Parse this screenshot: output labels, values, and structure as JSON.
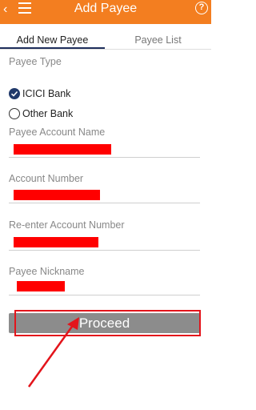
{
  "header": {
    "title": "Add Payee",
    "back_glyph": "‹",
    "help_glyph": "?",
    "bg_color": "#f37e20"
  },
  "tabs": [
    {
      "label": "Add New Payee",
      "active": true
    },
    {
      "label": "Payee List",
      "active": false
    }
  ],
  "form": {
    "payee_type_label": "Payee Type",
    "options": [
      {
        "label": "ICICI Bank",
        "selected": true
      },
      {
        "label": "Other Bank",
        "selected": false
      }
    ],
    "fields": [
      {
        "label": "Payee Account Name",
        "value_redacted": true
      },
      {
        "label": "Account Number",
        "value_redacted": true
      },
      {
        "label": "Re-enter Account Number",
        "value_redacted": true
      },
      {
        "label": "Payee Nickname",
        "value_redacted": true
      }
    ]
  },
  "proceed": {
    "label": "Proceed",
    "highlight_color": "#e3141b"
  }
}
